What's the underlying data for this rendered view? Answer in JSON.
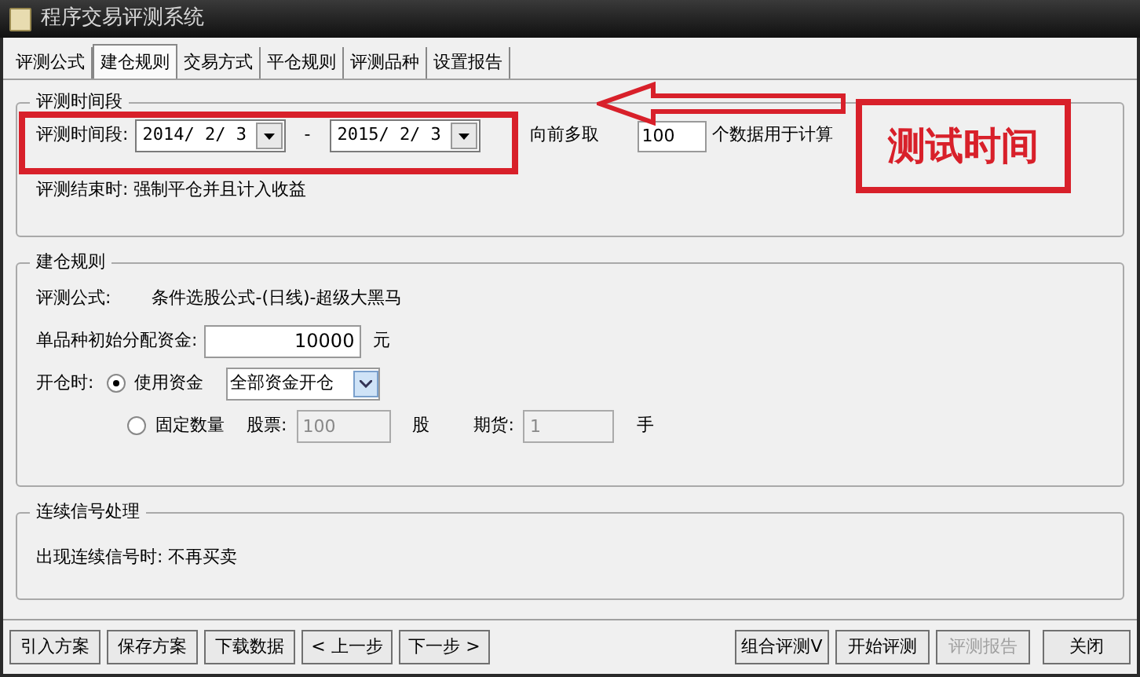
{
  "window": {
    "title": "程序交易评测系统"
  },
  "tabs": [
    {
      "label": "评测公式",
      "selected": false
    },
    {
      "label": "建仓规则",
      "selected": true
    },
    {
      "label": "交易方式",
      "selected": false
    },
    {
      "label": "平仓规则",
      "selected": false
    },
    {
      "label": "评测品种",
      "selected": false
    },
    {
      "label": "设置报告",
      "selected": false
    }
  ],
  "period": {
    "title": "评测时间段",
    "label": "评测时间段:",
    "start": "2014/ 2/ 3",
    "separator": "-",
    "end": "2015/ 2/ 3",
    "prefetch_label": "向前多取",
    "prefetch_value": "100",
    "prefetch_suffix": "个数据用于计算",
    "end_rule": "评测结束时: 强制平仓并且计入收益"
  },
  "annotation": {
    "text": "测试时间"
  },
  "entry": {
    "title": "建仓规则",
    "formula_label": "评测公式:",
    "formula": "条件选股公式-(日线)-超级大黑马",
    "capital_label": "单品种初始分配资金:",
    "capital": "10000",
    "capital_unit": "元",
    "open_label": "开仓时:",
    "options": [
      {
        "label": "使用资金",
        "selected": true,
        "kind": "select",
        "value": "全部资金开仓"
      },
      {
        "label": "固定数量",
        "selected": false,
        "kind": "quantity",
        "stock_label": "股票:",
        "stock": "100",
        "stock_unit": "股",
        "futures_label": "期货:",
        "futures": "1",
        "futures_unit": "手"
      }
    ]
  },
  "signals": {
    "title": "连续信号处理",
    "text": "出现连续信号时: 不再买卖"
  },
  "buttons": [
    {
      "label": "引入方案",
      "disabled": false
    },
    {
      "label": "保存方案",
      "disabled": false
    },
    {
      "label": "下载数据",
      "disabled": false
    },
    {
      "label": "< 上一步",
      "disabled": false
    },
    {
      "label": "下一步 >",
      "disabled": false
    }
  ],
  "right_buttons": [
    {
      "label": "组合评测V",
      "disabled": false
    },
    {
      "label": "开始评测",
      "disabled": false
    },
    {
      "label": "评测报告",
      "disabled": true
    },
    {
      "label": "关闭",
      "disabled": false
    }
  ]
}
